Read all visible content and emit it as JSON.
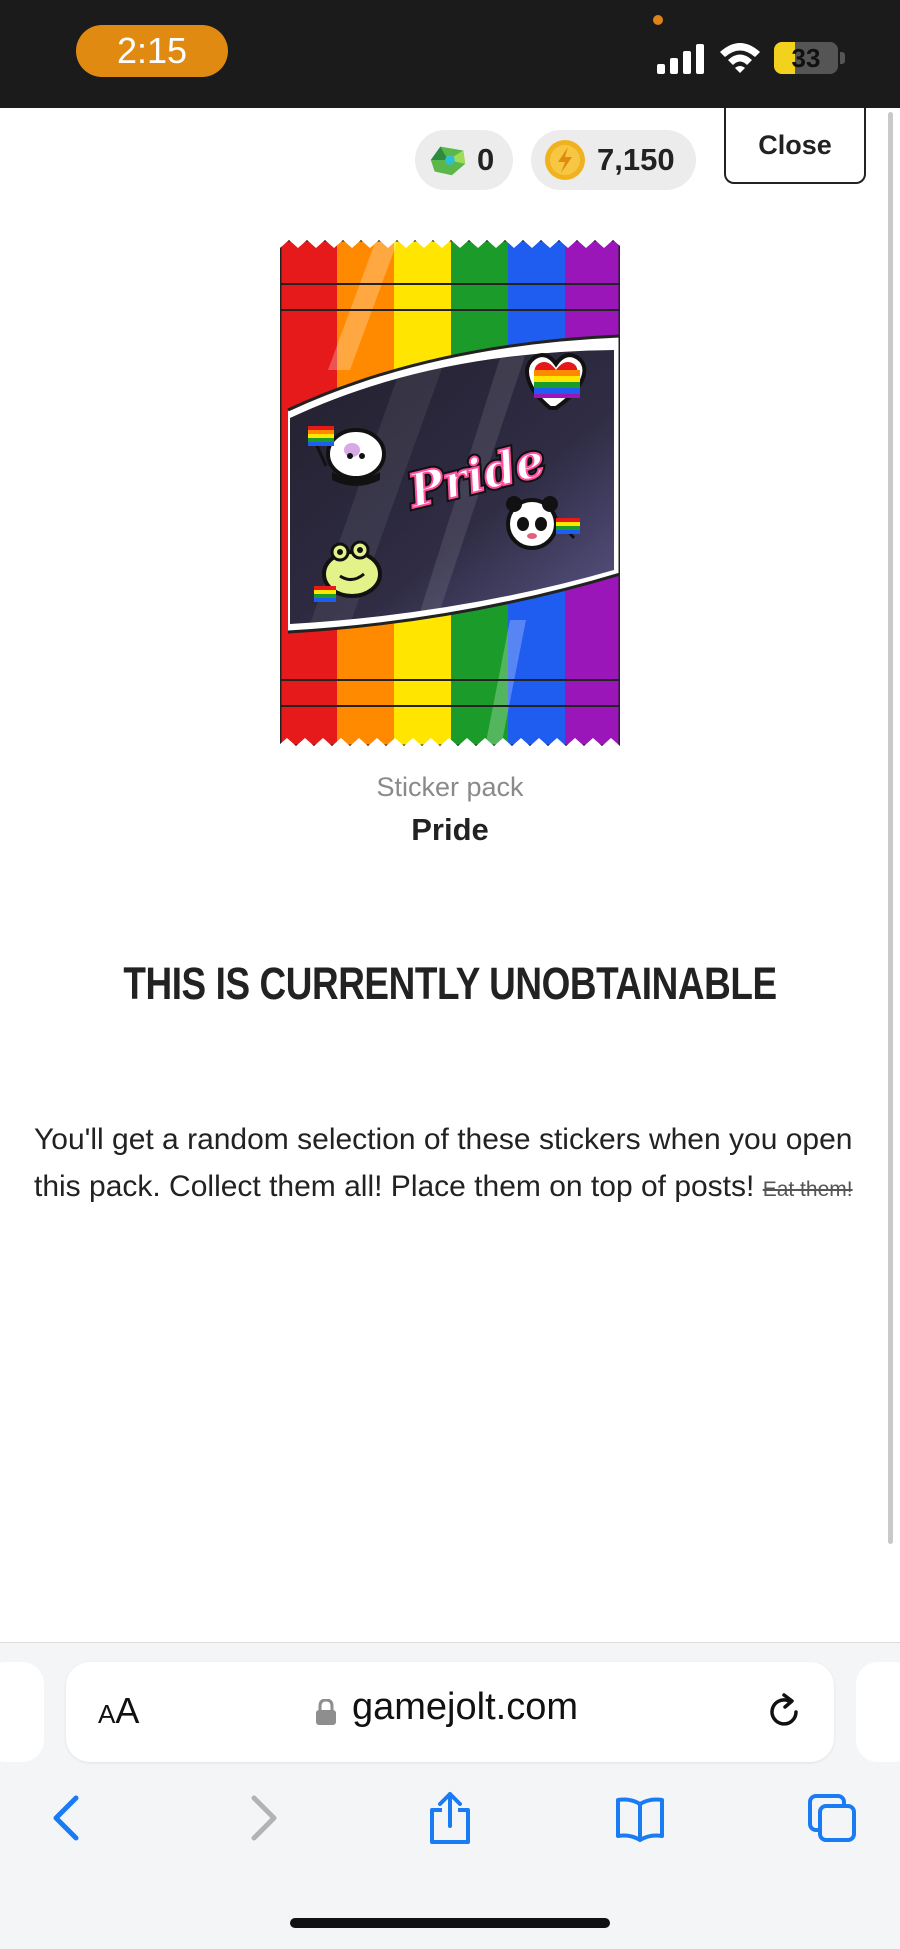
{
  "status_bar": {
    "time": "2:15",
    "battery": "33",
    "battery_level": 0.33
  },
  "wallet": {
    "gems": "0",
    "coins": "7,150"
  },
  "close_label": "Close",
  "pack": {
    "caption": "Sticker pack",
    "name": "Pride",
    "logo_text": "Pride"
  },
  "notice": "THIS IS CURRENTLY UNOBTAINABLE",
  "description": {
    "text": "You'll get a random selection of these stickers when you open this pack. Collect them all! Place them on top of posts!",
    "struck": "Eat them!"
  },
  "browser": {
    "text_size_label": "AA",
    "url": "gamejolt.com"
  },
  "colors": {
    "accent_orange": "#e08a12",
    "ios_blue": "#1a7cf5",
    "battery_yellow": "#f2d21d"
  },
  "icons": [
    "signal-icon",
    "wifi-icon",
    "battery-icon",
    "gem-icon",
    "coin-icon",
    "lock-icon",
    "reload-icon",
    "back-icon",
    "forward-icon",
    "share-icon",
    "bookmarks-icon",
    "tabs-icon"
  ]
}
